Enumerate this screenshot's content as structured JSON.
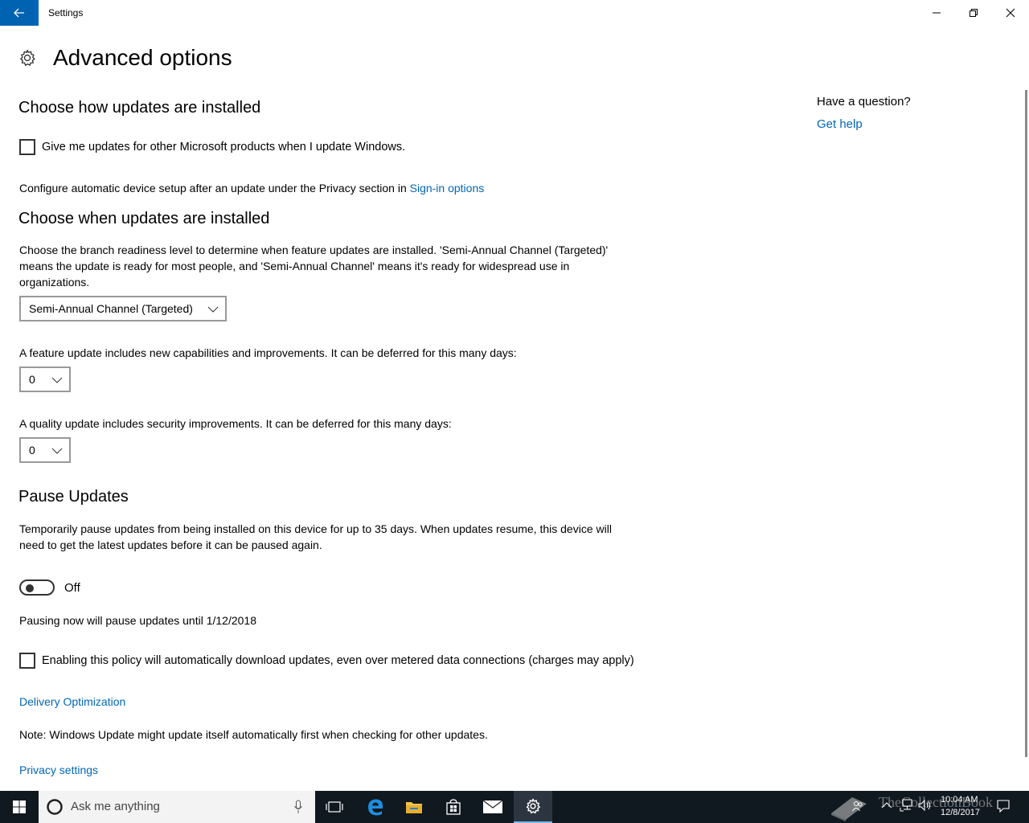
{
  "window": {
    "title": "Settings"
  },
  "page": {
    "title": "Advanced options"
  },
  "sidebar_help": {
    "question": "Have a question?",
    "get_help": "Get help"
  },
  "section_install_how": {
    "heading": "Choose how updates are installed",
    "checkbox_label": "Give me updates for other Microsoft products when I update Windows.",
    "checkbox_checked": false,
    "configure_text": "Configure automatic device setup after an update under the Privacy section in",
    "configure_link": "Sign-in options"
  },
  "section_install_when": {
    "heading": "Choose when updates are installed",
    "branch_desc_1": "Choose the branch readiness level to determine when feature updates are installed. 'Semi-Annual Channel (Targeted)'",
    "branch_desc_2": "means the update is ready for most people, and 'Semi-Annual Channel' means it's ready for widespread use in",
    "branch_desc_3": "organizations.",
    "branch_value": "Semi-Annual Channel (Targeted)",
    "feature_desc": "A feature update includes new capabilities and improvements. It can be deferred for this many days:",
    "feature_value": "0",
    "quality_desc": "A quality update includes security improvements. It can be deferred for this many days:",
    "quality_value": "0"
  },
  "section_pause": {
    "heading": "Pause Updates",
    "desc_1": "Temporarily pause updates from being installed on this device for up to 35 days. When updates resume, this device will",
    "desc_2": "need to get the latest updates before it can be paused again.",
    "toggle_state": "Off",
    "pause_until": "Pausing now will pause updates until 1/12/2018",
    "metered_label": "Enabling this policy will automatically download updates, even over metered data connections (charges may apply)",
    "metered_checked": false
  },
  "links": {
    "delivery": "Delivery Optimization",
    "note": "Note: Windows Update might update itself automatically first when checking for other updates.",
    "privacy": "Privacy settings"
  },
  "taskbar": {
    "search_placeholder": "Ask me anything",
    "time": "10:04 AM",
    "date": "12/8/2017",
    "watermark": "TheCollectionBook"
  },
  "colors": {
    "accent": "#0063b1",
    "link": "#0067b8",
    "taskbar": "#101820"
  }
}
